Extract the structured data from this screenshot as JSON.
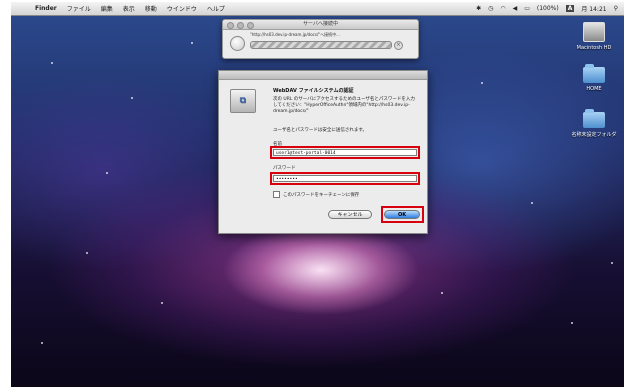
{
  "menubar": {
    "app": "Finder",
    "menus": [
      "ファイル",
      "編集",
      "表示",
      "移動",
      "ウインドウ",
      "ヘルプ"
    ],
    "status": {
      "battery": "(100%)",
      "input": "A",
      "datetime": "月 14:21"
    }
  },
  "desktop": {
    "icons": [
      {
        "label": "Macintosh HD"
      },
      {
        "label": "HOME"
      },
      {
        "label": "名称未設定フォルダ"
      }
    ]
  },
  "connect_window": {
    "title": "サーバへ接続中",
    "url": "\"http://hs03.dev.ip-dream.jp/docs/\"へ接続中..."
  },
  "dialog": {
    "title": "WebDAV ファイルシステムの認証",
    "message": "次の URL のサーバにアクセスするためのユーザ名とパスワードを入力してください：\"HyperOfficeAuthn\"領域内の\"http://hs03.dev.ip-dream.jp/docs/\"",
    "note": "ユーザ名とパスワードは安全に送信されます。",
    "name_label": "名前",
    "name_value": "user1@test-portal-0014",
    "password_label": "パスワード",
    "password_value": "••••••••",
    "keychain_label": "このパスワードをキーチェーンに保存",
    "cancel_label": "キャンセル",
    "ok_label": "OK"
  },
  "colors": {
    "highlight": "#d8000f",
    "ok_button": "#2f7ee0"
  }
}
